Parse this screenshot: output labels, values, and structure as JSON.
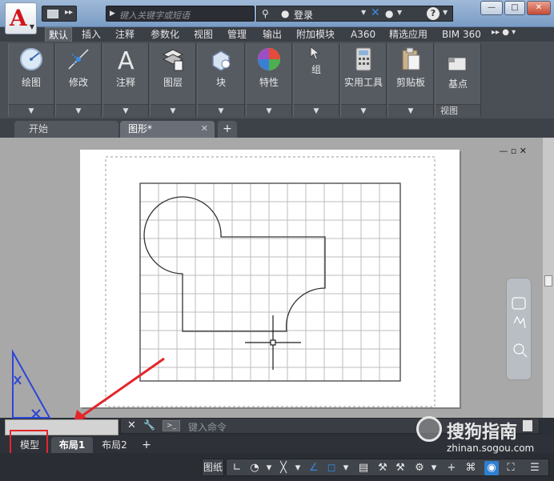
{
  "title_bar": {
    "app_logo": "A",
    "search_placeholder": "键入关键字或短语",
    "login_label": "登录",
    "help_label": "?"
  },
  "ribbon": {
    "tabs": [
      "默认",
      "插入",
      "注释",
      "参数化",
      "视图",
      "管理",
      "输出",
      "附加模块",
      "A360",
      "精选应用",
      "BIM 360"
    ],
    "active_tab": "默认",
    "panels": [
      {
        "label": "绘图",
        "icon": "draw-circle-icon"
      },
      {
        "label": "修改",
        "icon": "modify-icon"
      },
      {
        "label": "注释",
        "icon": "annotation-icon"
      },
      {
        "label": "图层",
        "icon": "layers-icon"
      },
      {
        "label": "块",
        "icon": "block-icon"
      },
      {
        "label": "特性",
        "icon": "color-wheel-icon"
      },
      {
        "label": "组",
        "icon": "group-icon"
      },
      {
        "label": "实用工具",
        "icon": "calculator-icon"
      },
      {
        "label": "剪贴板",
        "icon": "clipboard-icon"
      },
      {
        "label": "基点",
        "icon": "basepoint-icon"
      }
    ],
    "view_panel_label": "视图"
  },
  "file_tabs": {
    "start_label": "开始",
    "drawing_label": "图形*"
  },
  "command_line": {
    "placeholder": "键入命令"
  },
  "layout_tabs": {
    "model": "模型",
    "layout1": "布局1",
    "layout2": "布局2",
    "add": "+"
  },
  "status_bar": {
    "paper_label": "图纸"
  },
  "watermark": {
    "title": "搜狗指南",
    "subtitle": "zhinan.sogou.com"
  },
  "colors": {
    "highlight_red": "#e3262b",
    "logo_red": "#d2141b",
    "ucs_blue": "#2e46d6"
  }
}
